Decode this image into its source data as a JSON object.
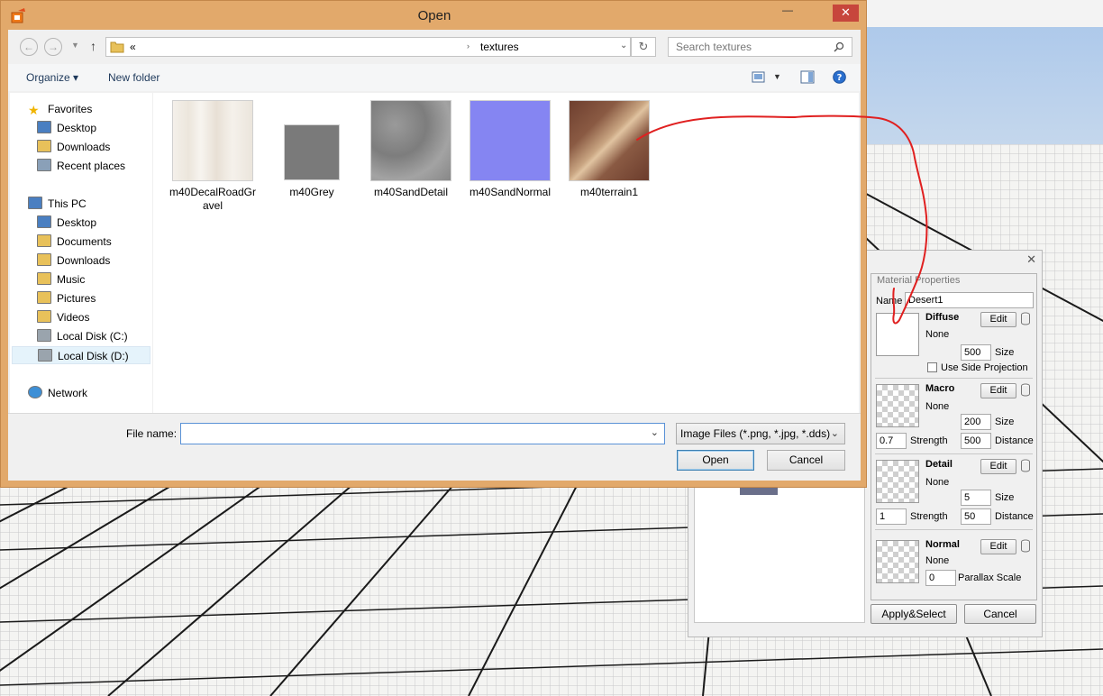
{
  "dialog": {
    "title": "Open",
    "close_glyph": "✕",
    "minimize_glyph": "—",
    "address_prefix": "«",
    "address_folder": "textures",
    "search_placeholder": "Search textures",
    "organize_label": "Organize ▾",
    "new_folder_label": "New folder",
    "nav": {
      "favorites": "Favorites",
      "fav_items": [
        "Desktop",
        "Downloads",
        "Recent places"
      ],
      "this_pc": "This PC",
      "pc_items": [
        "Desktop",
        "Documents",
        "Downloads",
        "Music",
        "Pictures",
        "Videos",
        "Local Disk (C:)",
        "Local Disk (D:)"
      ],
      "selected": "Local Disk (D:)",
      "network": "Network"
    },
    "files": [
      {
        "name": "m40DecalRoadGr\navel",
        "icon": "road-decal-texture"
      },
      {
        "name": "m40Grey",
        "icon": "grey-texture"
      },
      {
        "name": "m40SandDetail",
        "icon": "sand-detail-texture"
      },
      {
        "name": "m40SandNormal",
        "icon": "normal-map-texture"
      },
      {
        "name": "m40terrain1",
        "icon": "terrain-texture"
      }
    ],
    "file_name_label": "File name:",
    "file_name_value": "",
    "file_type": "Image Files (*.png, *.jpg, *.dds)",
    "open_label": "Open",
    "cancel_label": "Cancel"
  },
  "material": {
    "close_glyph": "✕",
    "section_title": "Material Properties",
    "name_label": "Name",
    "name_value": "Desert1",
    "edit_label": "Edit",
    "diffuse": {
      "title": "Diffuse",
      "value": "None",
      "size": "500",
      "size_label": "Size",
      "side_projection": "Use Side Projection"
    },
    "macro": {
      "title": "Macro",
      "value": "None",
      "size": "200",
      "size_label": "Size",
      "strength": "0.7",
      "strength_label": "Strength",
      "distance": "500",
      "distance_label": "Distance"
    },
    "detail": {
      "title": "Detail",
      "value": "None",
      "size": "5",
      "size_label": "Size",
      "strength": "1",
      "strength_label": "Strength",
      "distance": "50",
      "distance_label": "Distance"
    },
    "normal": {
      "title": "Normal",
      "value": "None",
      "parallax": "0",
      "parallax_label": "Parallax Scale"
    },
    "apply_label": "Apply&Select",
    "cancel_label": "Cancel"
  },
  "colors": {
    "titlebar": "#e2a96b",
    "close_red": "#c7463c",
    "annotation": "#e02020",
    "sky": "#c4d6ec"
  }
}
